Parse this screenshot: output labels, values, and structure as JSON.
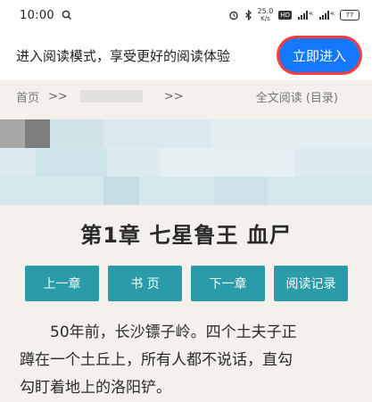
{
  "status_bar": {
    "time": "10:00",
    "speed_top": "25.0",
    "speed_bottom": "K/s",
    "hd": "HD",
    "battery": "77"
  },
  "banner": {
    "text": "进入阅读模式，享受更好的阅读体验",
    "button_label": "立即进入"
  },
  "breadcrumb": {
    "home": "首页",
    "separator": ">>",
    "right_link": "全文阅读 (目录)"
  },
  "chapter": {
    "title": "第1章 七星鲁王 血尸"
  },
  "nav_buttons": [
    {
      "label": "上一章"
    },
    {
      "label": "书 页"
    },
    {
      "label": "下一章"
    },
    {
      "label": "阅读记录"
    }
  ],
  "content": {
    "line1": "50年前，长沙镖子岭。四个土夫子正",
    "line2": "蹲在一个土丘上，所有人都不说话，直勾",
    "line3": "勾盯着地上的洛阳铲。"
  },
  "colors": {
    "accent_blue": "#1677ff",
    "nav_teal": "#2a9ba8",
    "highlight_red": "#ff3b3b"
  }
}
